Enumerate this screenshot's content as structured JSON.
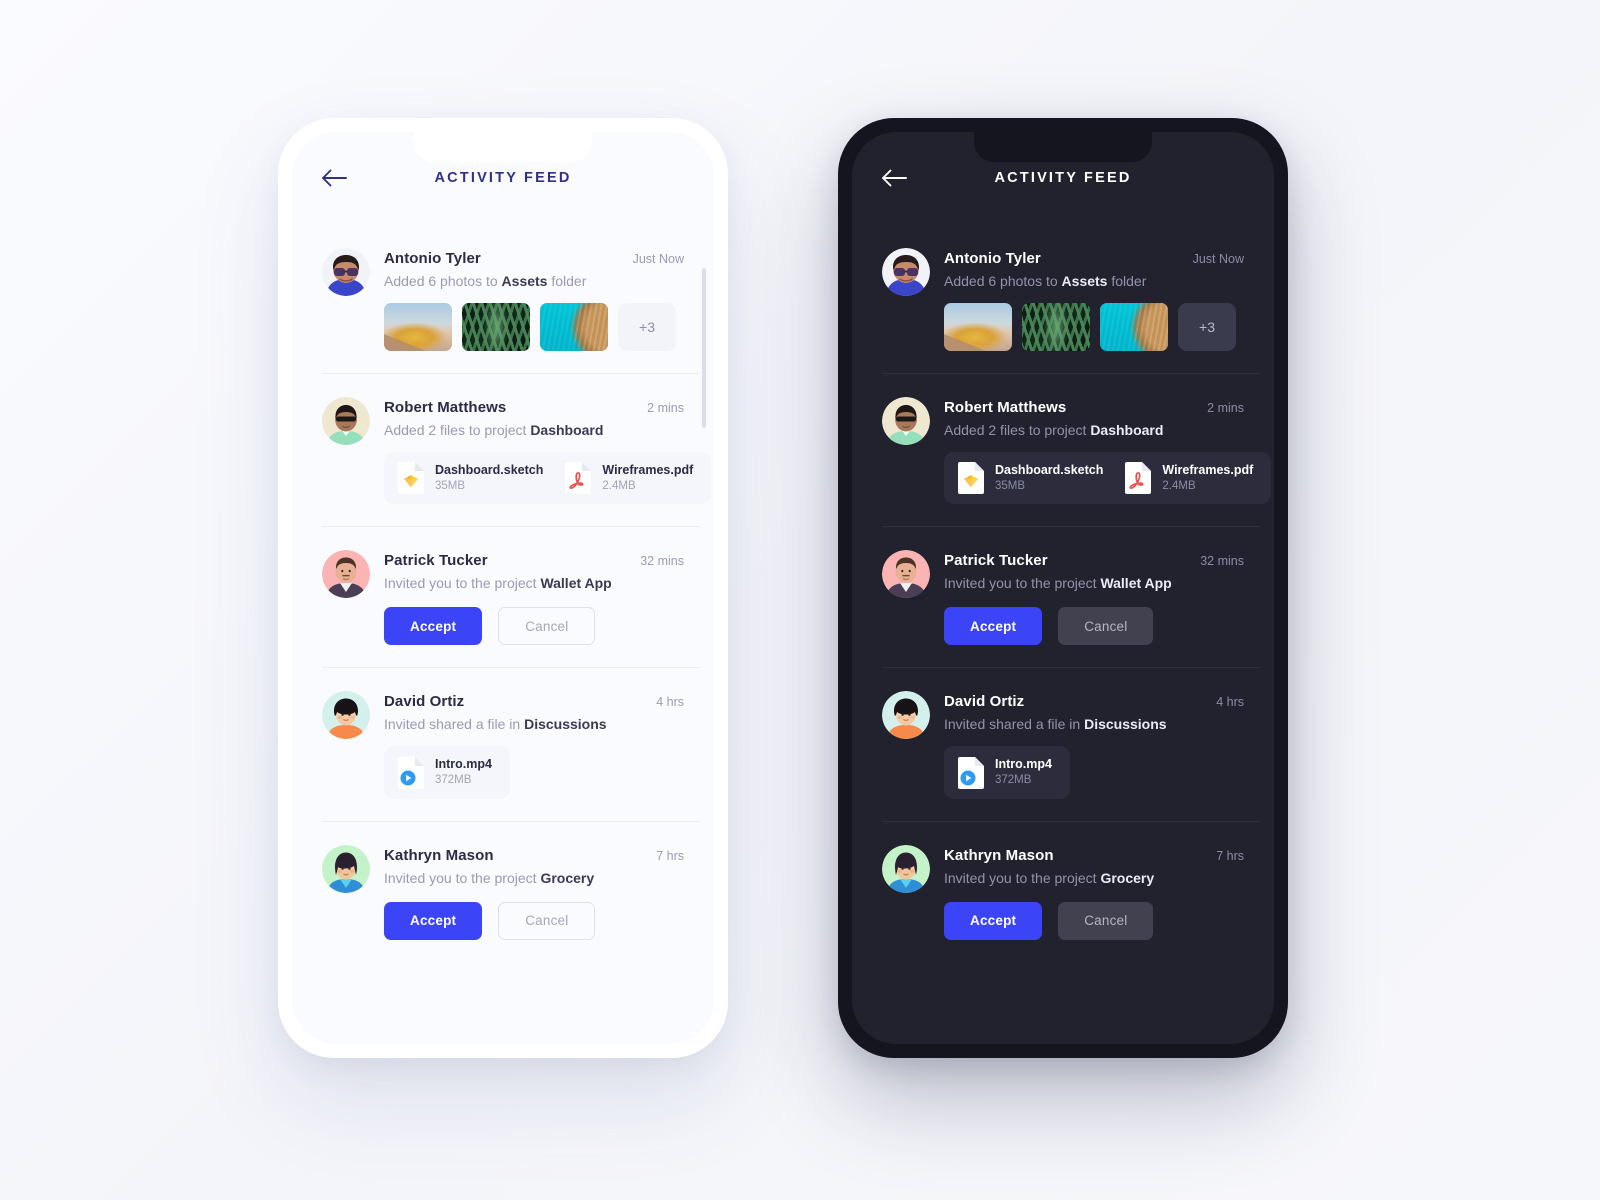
{
  "theme": {
    "page_bg": "#f7f8fc",
    "light_screen_bg": "#fafbfe",
    "dark_screen_bg": "#22222f",
    "accent": "#3b44f6",
    "light_title_color": "#30308b",
    "dark_title_color": "#ffffff"
  },
  "header": {
    "title": "ACTIVITY FEED",
    "back_icon": "arrow-left-icon"
  },
  "feed": {
    "items": [
      {
        "id": "antonio-tyler",
        "name": "Antonio Tyler",
        "time": "Just Now",
        "desc_pre": "Added 6 photos to ",
        "desc_bold": "Assets",
        "desc_post": " folder",
        "type": "photos",
        "photos": [
          {
            "alt": "golden-pavilion-sky-photo"
          },
          {
            "alt": "green-fern-leaf-photo"
          },
          {
            "alt": "teal-wood-texture-photo"
          }
        ],
        "more_label": "+3"
      },
      {
        "id": "robert-matthews",
        "name": "Robert Matthews",
        "time": "2 mins",
        "desc_pre": "Added 2 files to project ",
        "desc_bold": "Dashboard",
        "desc_post": "",
        "type": "files",
        "files": [
          {
            "name": "Dashboard.sketch",
            "size": "35MB",
            "icon": "sketch-file-icon"
          },
          {
            "name": "Wireframes.pdf",
            "size": "2.4MB",
            "icon": "pdf-file-icon"
          }
        ]
      },
      {
        "id": "patrick-tucker",
        "name": "Patrick Tucker",
        "time": "32 mins",
        "desc_pre": "Invited you to the project ",
        "desc_bold": "Wallet App",
        "desc_post": "",
        "type": "invite",
        "accept_label": "Accept",
        "cancel_label": "Cancel"
      },
      {
        "id": "david-ortiz",
        "name": "David Ortiz",
        "time": "4 hrs",
        "desc_pre": "Invited shared a file in ",
        "desc_bold": "Discussions",
        "desc_post": "",
        "type": "files",
        "files": [
          {
            "name": "Intro.mp4",
            "size": "372MB",
            "icon": "video-file-icon"
          }
        ]
      },
      {
        "id": "kathryn-mason",
        "name": "Kathryn Mason",
        "time": "7 hrs",
        "desc_pre": "Invited you to the project ",
        "desc_bold": "Grocery",
        "desc_post": "",
        "type": "invite",
        "accept_label": "Accept",
        "cancel_label": "Cancel"
      }
    ]
  }
}
